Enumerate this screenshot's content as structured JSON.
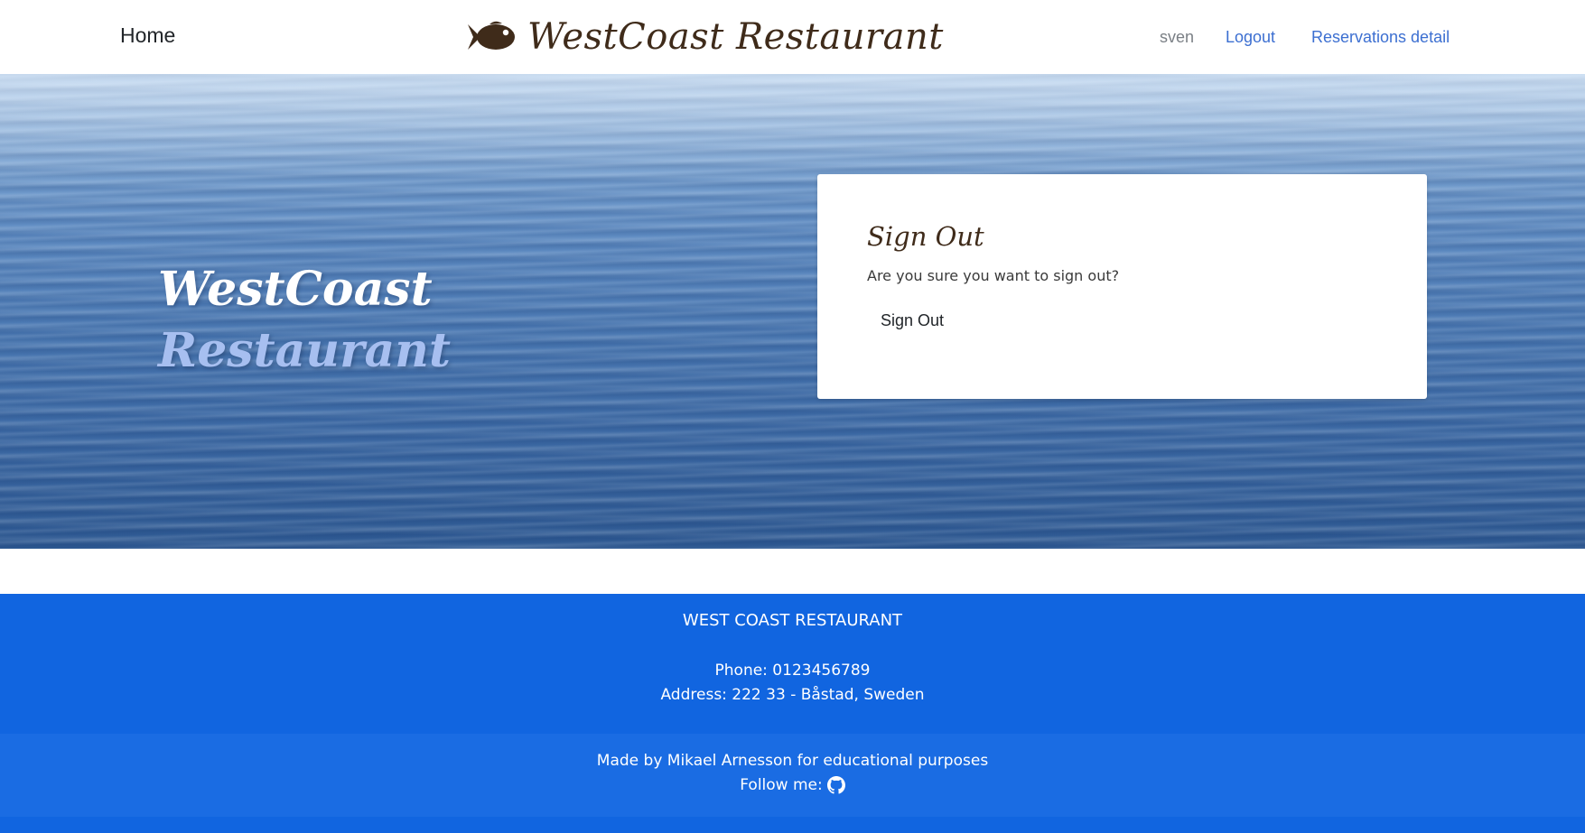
{
  "navbar": {
    "home_label": "Home",
    "brand_text": "WestCoast Restaurant",
    "brand_icon": "fish-icon",
    "username": "sven",
    "logout_label": "Logout",
    "reservations_label": "Reservations detail"
  },
  "hero": {
    "title_line1": "WestCoast",
    "title_line2": "Restaurant"
  },
  "signout_card": {
    "title": "Sign Out",
    "message": "Are you sure you want to sign out?",
    "button_label": "Sign Out"
  },
  "footer": {
    "restaurant_name": "WEST COAST RESTAURANT",
    "phone": "Phone: 0123456789",
    "address": "Address: 222 33 - Båstad, Sweden",
    "credit": "Made by Mikael Arnesson for educational purposes",
    "follow_label": "Follow me:",
    "follow_icon": "github-icon"
  },
  "colors": {
    "brand_brown": "#3f2b1a",
    "link_blue": "#3c6fd1",
    "footer_blue": "#1165e0",
    "footer_blue_light": "#1a6ce3",
    "hero_title_secondary": "#a7bff0"
  }
}
